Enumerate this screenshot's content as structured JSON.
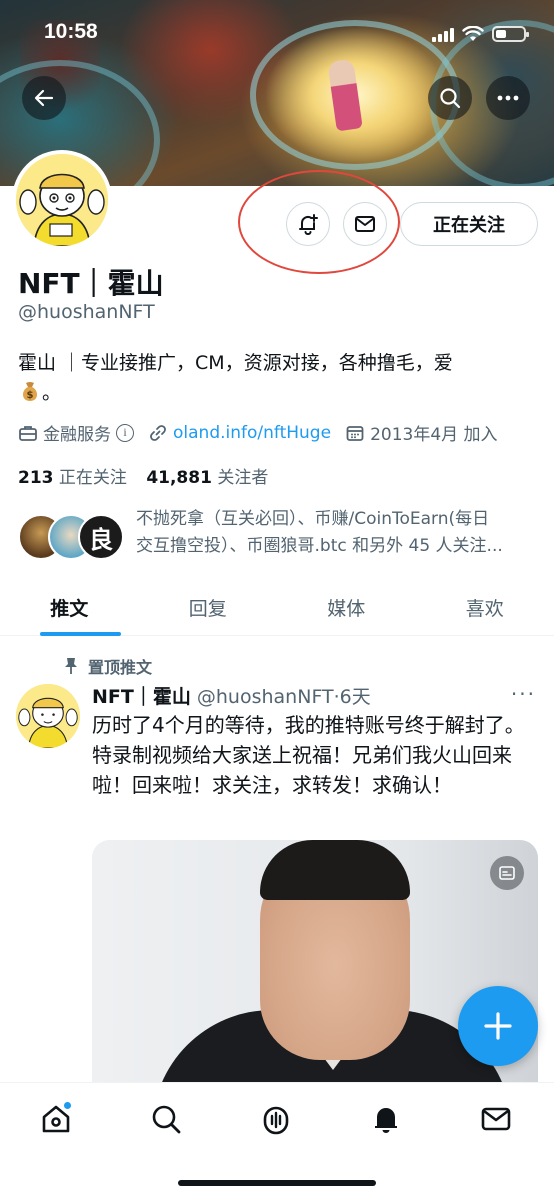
{
  "status_bar": {
    "time": "10:58"
  },
  "icons": {
    "back": "arrow-left-icon",
    "search": "search-icon",
    "more": "more-icon",
    "notify": "bell-plus-icon",
    "message": "envelope-icon",
    "briefcase": "briefcase-icon",
    "link": "link-icon",
    "calendar": "calendar-icon",
    "pin": "pin-icon",
    "compose": "plus-icon",
    "money_bag": "money-bag-emoji"
  },
  "profile": {
    "follow_button": "正在关注",
    "name": "NFT｜霍山",
    "handle": "@huoshanNFT",
    "bio": "霍山 ｜专业接推广，CM，资源对接，各种撸毛，爱",
    "bio_tail": "。",
    "category": "金融服务",
    "info_mark": "i",
    "website": "oland.info/nftHuge",
    "joined": "2013年4月 加入",
    "following_count": "213",
    "following_label": "正在关注",
    "followers_count": "41,881",
    "followers_label": "关注者",
    "followed_by_line1": "不抛死拿（互关必回）、币赚/CoinToEarn(每日",
    "followed_by_line2": "交互撸空投）、币圈狼哥.btc 和另外 45 人关注...",
    "mini_avatar_char": "良"
  },
  "tabs": [
    "推文",
    "回复",
    "媒体",
    "喜欢"
  ],
  "active_tab": 0,
  "tweet": {
    "pinned_label": "置顶推文",
    "author_name": "NFT｜霍山",
    "author_handle": "@huoshanNFT",
    "time": "·6天",
    "more": "···",
    "text": "历时了4个月的等待，我的推特账号终于解封了。特录制视频给大家送上祝福！兄弟们我火山回来啦！回来啦！求关注，求转发！求确认！"
  },
  "bottom_nav": [
    "home",
    "explore",
    "spaces",
    "notifications",
    "messages"
  ],
  "colors": {
    "accent": "#1d9bf0",
    "annotation": "#e0483d",
    "text": "#0f1419",
    "secondary": "#536471"
  }
}
